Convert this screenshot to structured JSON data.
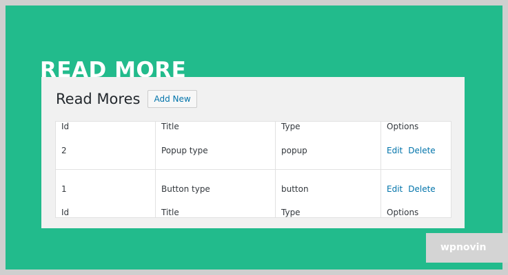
{
  "banner": {
    "title": "READ MORE",
    "background_color": "#22bb8c"
  },
  "page": {
    "title": "Read Mores",
    "add_new_label": "Add New"
  },
  "table": {
    "headers": [
      "Id",
      "Title",
      "Type",
      "Options"
    ],
    "rows": [
      {
        "id": "2",
        "title": "Popup type",
        "type": "popup",
        "edit_label": "Edit",
        "delete_label": "Delete"
      },
      {
        "id": "1",
        "title": "Button type",
        "type": "button",
        "edit_label": "Edit",
        "delete_label": "Delete"
      }
    ],
    "footers": [
      "Id",
      "Title",
      "Type",
      "Options"
    ]
  },
  "watermark": {
    "text": "wpnovin"
  },
  "colors": {
    "accent_link": "#0073aa",
    "panel_background": "#f1f1f1"
  }
}
